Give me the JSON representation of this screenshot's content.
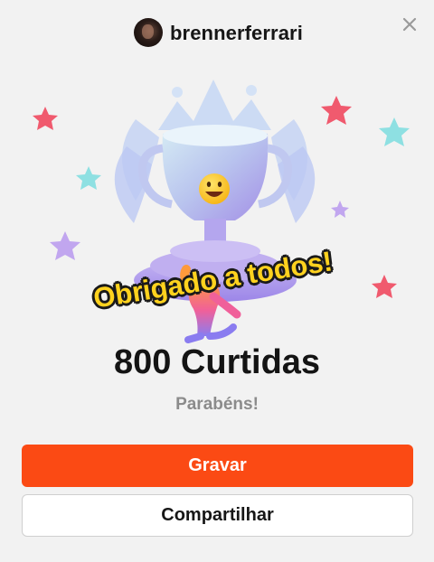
{
  "header": {
    "username": "brennerferrari"
  },
  "celebration": {
    "caption": "Obrigado a todos!"
  },
  "milestone": {
    "title": "800 Curtidas",
    "subtitle": "Parabéns!"
  },
  "actions": {
    "record_label": "Gravar",
    "share_label": "Compartilhar"
  },
  "colors": {
    "primary": "#fb4a14",
    "caption": "#ffd21e"
  }
}
